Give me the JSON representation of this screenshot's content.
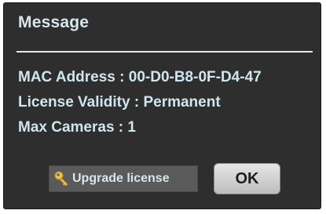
{
  "dialog": {
    "title": "Message",
    "mac_address": "MAC Address : 00-D0-B8-0F-D4-47",
    "license_validity": "License Validity : Permanent",
    "max_cameras": "Max Cameras : 1",
    "upgrade_label": "Upgrade license",
    "ok_label": "OK",
    "upgrade_icon": "key-icon"
  },
  "colors": {
    "dialog_background": "#2e2e2e",
    "text": "#cfe6ee",
    "key_icon": "#f0c050"
  }
}
